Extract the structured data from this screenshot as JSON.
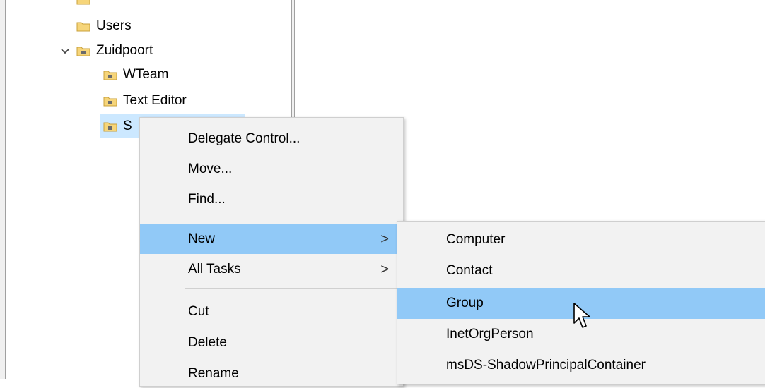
{
  "tree": {
    "items": [
      {
        "label": "Users"
      },
      {
        "label": "Zuidpoort"
      },
      {
        "label": "WTeam"
      },
      {
        "label": "Text Editor"
      },
      {
        "label": "S"
      }
    ]
  },
  "context_menu": {
    "items": [
      {
        "label": "Delegate Control..."
      },
      {
        "label": "Move..."
      },
      {
        "label": "Find..."
      },
      {
        "label": "New",
        "arrow": ">"
      },
      {
        "label": "All Tasks",
        "arrow": ">"
      },
      {
        "label": "Cut"
      },
      {
        "label": "Delete"
      },
      {
        "label": "Rename"
      }
    ]
  },
  "submenu": {
    "items": [
      {
        "label": "Computer"
      },
      {
        "label": "Contact"
      },
      {
        "label": "Group"
      },
      {
        "label": "InetOrgPerson"
      },
      {
        "label": "msDS-ShadowPrincipalContainer"
      }
    ]
  },
  "colors": {
    "highlight": "#91c9f7",
    "selected_tree": "#cce8ff",
    "menu_bg": "#f2f2f2"
  }
}
